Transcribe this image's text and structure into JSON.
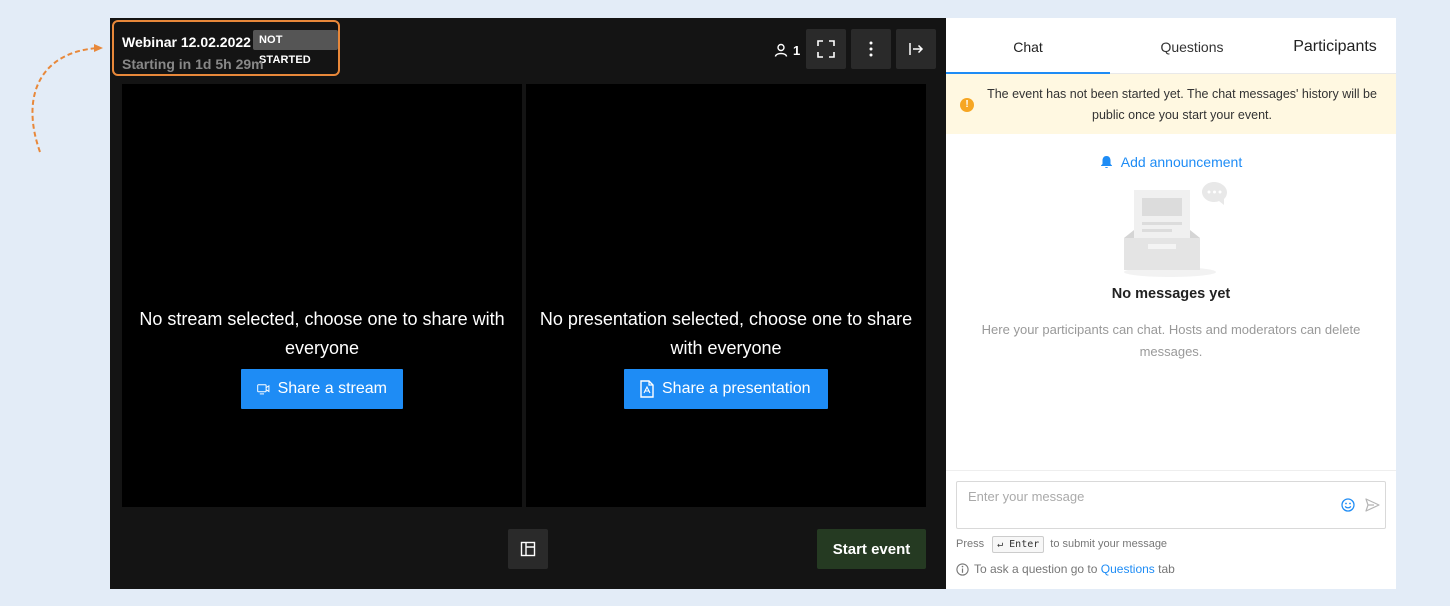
{
  "player": {
    "title": "Webinar 12.02.2022",
    "status_badge": "NOT STARTED",
    "countdown": "Starting in 1d 5h 29m",
    "attendee_count": "1",
    "stream_pane": {
      "message": "No stream selected, choose one to share with everyone",
      "button_label": "Share a stream"
    },
    "presentation_pane": {
      "message": "No presentation selected, choose one to share with everyone",
      "button_label": "Share a presentation"
    },
    "start_button_label": "Start event"
  },
  "sidebar": {
    "tabs": [
      {
        "label": "Chat",
        "active": true
      },
      {
        "label": "Questions",
        "active": false
      },
      {
        "label": "Participants",
        "active": false
      }
    ],
    "notice": "The event has not been started yet. The chat messages' history will be public once you start your event.",
    "announcement_link": "Add announcement",
    "empty_title": "No messages yet",
    "empty_description": "Here your participants can chat. Hosts and moderators can delete messages.",
    "composer": {
      "placeholder": "Enter your message",
      "hint_prefix": "Press",
      "hint_key": "↵ Enter",
      "hint_suffix": "to submit your message",
      "question_hint_prefix": "To ask a question go to",
      "question_hint_link": "Questions",
      "question_hint_suffix": "tab"
    }
  },
  "colors": {
    "accent": "#1e8cf5",
    "highlight_border": "#e8883a",
    "start_button": "#253a22",
    "notice_background": "#fff8e1"
  },
  "icons": [
    "user-icon",
    "fullscreen-icon",
    "more-vertical-icon",
    "exit-icon",
    "video-share-icon",
    "pdf-file-icon",
    "layout-icon",
    "bell-icon",
    "warning-icon",
    "emoji-icon",
    "send-icon",
    "info-icon"
  ]
}
